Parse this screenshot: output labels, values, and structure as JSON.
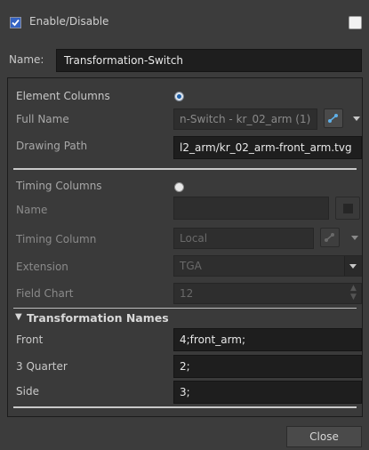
{
  "header": {
    "enable_label": "Enable/Disable",
    "enable_checked": true
  },
  "name": {
    "label": "Name:",
    "value": "Transformation-Switch"
  },
  "element_columns": {
    "label": "Element Columns",
    "full_name_label": "Full Name",
    "full_name_value": "n-Switch - kr_02_arm (1)",
    "drawing_path_label": "Drawing Path",
    "drawing_path_value": "l2_arm/kr_02_arm-front_arm.tvg"
  },
  "timing_columns": {
    "label": "Timing Columns",
    "name_label": "Name",
    "name_value": "",
    "timing_column_label": "Timing Column",
    "timing_column_value": "Local",
    "extension_label": "Extension",
    "extension_value": "TGA",
    "field_chart_label": "Field Chart",
    "field_chart_value": "12"
  },
  "transformation_names": {
    "label": "Transformation Names",
    "rows": [
      {
        "label": "Front",
        "value": "4;front_arm;"
      },
      {
        "label": "3 Quarter",
        "value": "2;"
      },
      {
        "label": "Side",
        "value": "3;"
      }
    ]
  },
  "footer": {
    "close_label": "Close"
  },
  "colors": {
    "accent": "#4aa3df",
    "background": "#3c3c3c",
    "field": "#1e1e1e"
  },
  "icons": [
    "checkbox-checked-icon",
    "checkbox-icon",
    "radio-selected-icon",
    "radio-icon",
    "link-icon",
    "chevron-down-icon",
    "spin-arrows-icon",
    "triangle-down-icon"
  ]
}
